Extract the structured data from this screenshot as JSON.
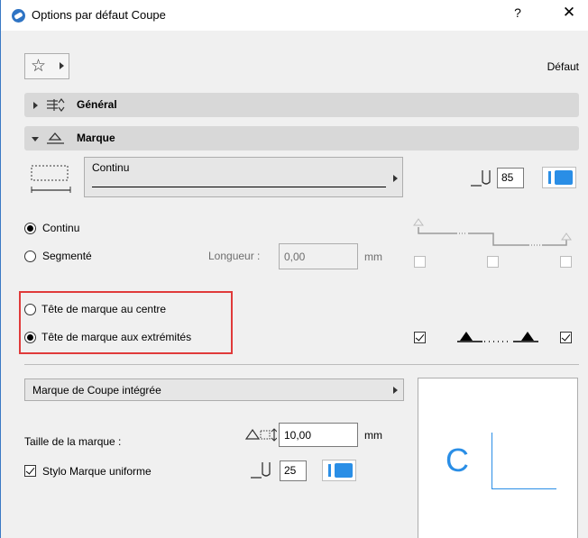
{
  "window": {
    "title": "Options par défaut Coupe",
    "help": "?",
    "close": "✕"
  },
  "toolbar": {
    "favorites_icon": "star-icon",
    "default_label": "Défaut"
  },
  "sections": {
    "general": {
      "title": "Général",
      "expanded": false
    },
    "marker": {
      "title": "Marque",
      "expanded": true
    }
  },
  "line": {
    "type_label": "Continu",
    "pen_number": "85",
    "pen_color": "#2a8ee6"
  },
  "line_mode": {
    "options": [
      "Continu",
      "Segmenté"
    ],
    "selected": "Continu",
    "length_label": "Longueur :",
    "length_value": "0,00",
    "length_unit": "mm"
  },
  "marker_position": {
    "options": [
      "Tête de marque au centre",
      "Tête de marque aux extrémités"
    ],
    "selected": "Tête de marque aux extrémités",
    "left_end_checked": true,
    "right_end_checked": true
  },
  "marker_type": {
    "label": "Marque de Coupe intégrée"
  },
  "marker_size": {
    "label": "Taille de la marque :",
    "value": "10,00",
    "unit": "mm"
  },
  "uniform_pen": {
    "label": "Stylo Marque uniforme",
    "checked": true,
    "pen_number": "25",
    "pen_color": "#2a8ee6"
  },
  "preview": {
    "letter": "C",
    "color": "#2a8ee6"
  }
}
